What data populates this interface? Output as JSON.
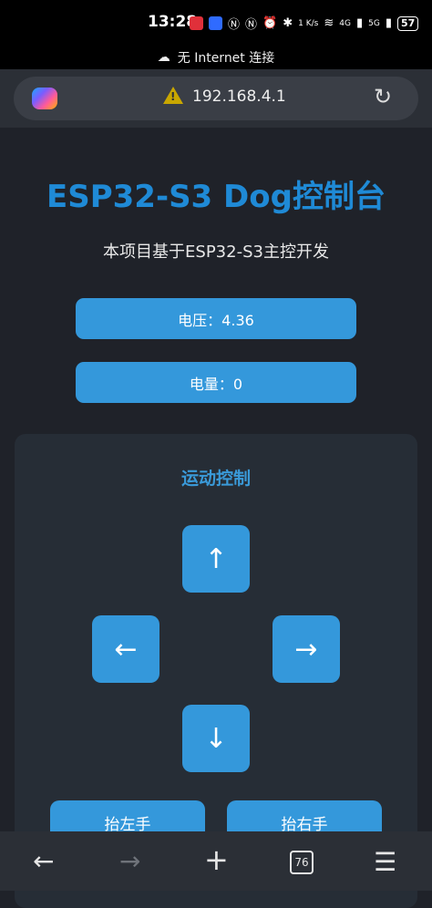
{
  "status_bar": {
    "time": "13:28",
    "net_speed": "1 K/s",
    "signal_4g": "4G",
    "signal_5g": "5G",
    "battery": "57"
  },
  "network_banner": {
    "text": "无 Internet 连接"
  },
  "browser": {
    "url": "192.168.4.1"
  },
  "page": {
    "title": "ESP32-S3 Dog控制台",
    "subtitle": "本项目基于ESP32-S3主控开发",
    "voltage_label": "电压：4.36",
    "battery_label": "电量：0",
    "motion_title": "运动控制",
    "arrows": {
      "up": "↑",
      "left": "←",
      "right": "→",
      "down": "↓"
    },
    "actions": {
      "raise_left": "抬左手",
      "raise_right": "抬右手"
    }
  },
  "bottom_nav": {
    "tabs_count": "76"
  },
  "colors": {
    "accent": "#3498db",
    "title": "#1f8ad6",
    "background": "#1f2229"
  }
}
